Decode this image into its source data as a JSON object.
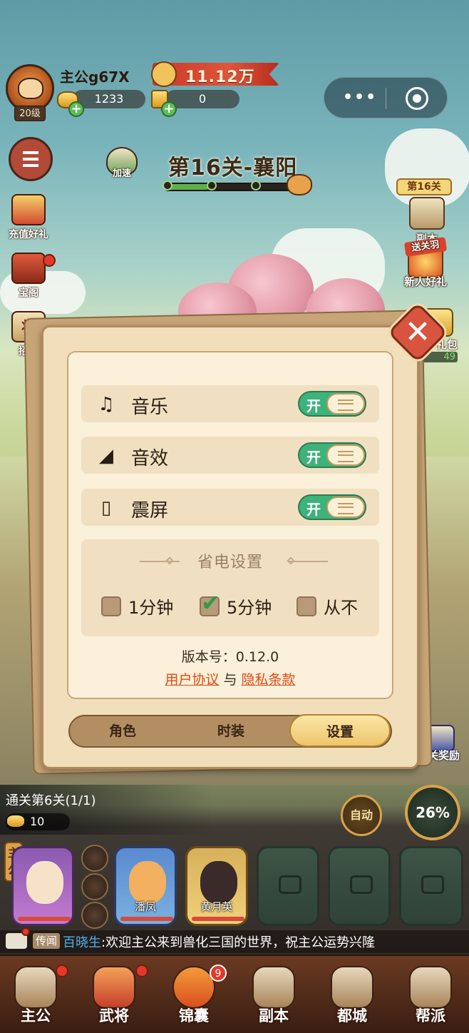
{
  "colors": {
    "toggle_on": "#3db27a",
    "link": "#e24a18",
    "panel_bg": "#f1dfbb",
    "close_red": "#d8543e",
    "checkbox_check": "#2f9a48"
  },
  "hud": {
    "player_name": "主公g67X",
    "level": "20级",
    "gold": "1233",
    "tokens": "0",
    "combat_power": "11.12万"
  },
  "left_menu": {
    "recharge_gift": "充值好礼",
    "treasure_pavilion": "宝阁",
    "recruit_char": "将",
    "recruit": "招募"
  },
  "speed_up": "加速",
  "stage": {
    "title": "第16关-襄阳",
    "progress": 0.33
  },
  "right_menu": {
    "stage_tag": "第16关",
    "dungeon": "副本",
    "newbie_ribbon": "送关羽",
    "newbie_gift": "新人好礼",
    "gift_pack": "礼包",
    "gift_timer": "49",
    "pass_reward": "通关奖励"
  },
  "settings": {
    "rows": [
      {
        "icon": "music-note-icon",
        "label": "音乐",
        "toggle": "开"
      },
      {
        "icon": "sound-effect-icon",
        "label": "音效",
        "toggle": "开"
      },
      {
        "icon": "vibrate-icon",
        "label": "震屏",
        "toggle": "开"
      }
    ],
    "power_saving": {
      "title": "省电设置",
      "options": [
        {
          "label": "1分钟",
          "checked": false
        },
        {
          "label": "5分钟",
          "checked": true
        },
        {
          "label": "从不",
          "checked": false
        }
      ]
    },
    "version": "版本号：0.12.0",
    "user_agreement": "用户协议",
    "and": "与",
    "privacy": "隐私条款",
    "tabs": {
      "role": "角色",
      "fashion": "时装",
      "settings": "设置"
    }
  },
  "battle": {
    "clear_text": "通关第6关(1/1)",
    "clear_reward": "10",
    "auto": "自动",
    "percent": "26%"
  },
  "team": {
    "lord_tag": "主公",
    "heroes": [
      "潘凤",
      "黄月英"
    ]
  },
  "news": {
    "tag": "传闻",
    "speaker": "百晓生",
    "message": ":欢迎主公来到兽化三国的世界，祝主公运势兴隆"
  },
  "nav": {
    "lord": "主公",
    "generals": "武将",
    "bag": "锦囊",
    "bag_badge": "9",
    "dungeon": "副本",
    "city": "都城",
    "guild": "帮派"
  }
}
